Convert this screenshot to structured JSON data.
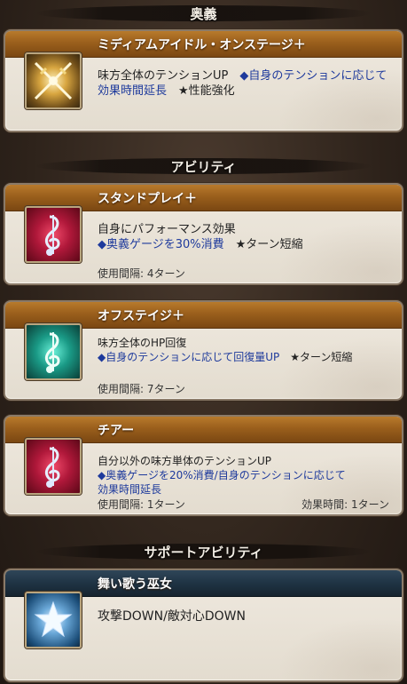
{
  "sections": {
    "ougi": "奥義",
    "ability": "アビリティ",
    "support": "サポートアビリティ"
  },
  "cards": [
    {
      "title": "ミディアムアイドル・オンステージ＋",
      "icon": "crossed-swords-icon",
      "desc_black": "味方全体のテンションUP　",
      "desc_blue": "◆自身のテンションに応じて効果時間延長",
      "desc_tail": "　★性能強化"
    },
    {
      "title": "スタンドプレイ＋",
      "icon": "red-music-note-icon",
      "desc_black": "自身にパフォーマンス効果",
      "desc_blue": "◆奥義ゲージを30%消費",
      "desc_tail": "　★ターン短縮",
      "cooldown": "使用間隔: 4ターン"
    },
    {
      "title": "オフステイジ＋",
      "icon": "teal-music-note-icon",
      "desc_black": "味方全体のHP回復",
      "desc_blue": "◆自身のテンションに応じて回復量UP",
      "desc_tail": "　★ターン短縮",
      "cooldown": "使用間隔: 7ターン"
    },
    {
      "title": "チアー",
      "icon": "red-music-note-icon",
      "desc_black": "自分以外の味方単体のテンションUP",
      "desc_blue": "◆奥義ゲージを20%消費/自身のテンションに応じて",
      "desc_blue2": "効果時間延長",
      "cooldown": "使用間隔: 1ターン",
      "duration": "効果時間: 1ターン"
    },
    {
      "title": "舞い歌う巫女",
      "icon": "blue-star-icon",
      "desc_black": "攻撃DOWN/敵対心DOWN"
    }
  ]
}
